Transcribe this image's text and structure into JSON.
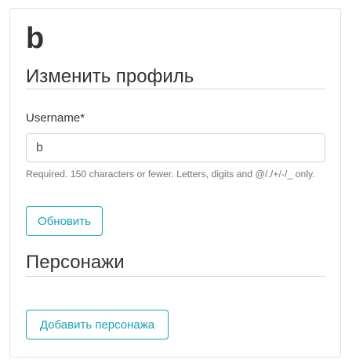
{
  "profile": {
    "username": "b"
  },
  "edit_section": {
    "title": "Изменить профиль",
    "username_label": "Username*",
    "username_value": "b",
    "help_text": "Required. 150 characters or fewer. Letters, digits and @/./+/-/_ only.",
    "submit_label": "Обновить"
  },
  "characters_section": {
    "title": "Персонажи",
    "add_label": "Добавить персонажа"
  },
  "colors": {
    "accent": "#17a2b8",
    "border": "#dee2e6",
    "muted_text": "#6c757d"
  }
}
